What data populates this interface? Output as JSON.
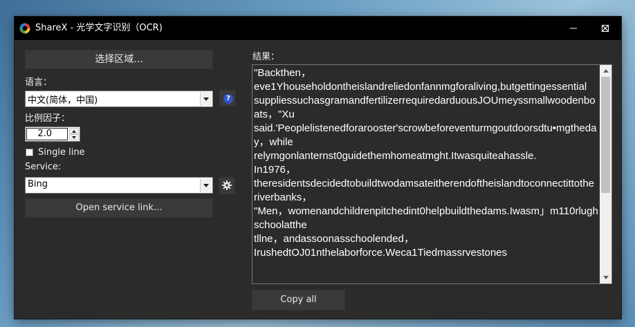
{
  "window": {
    "title": "ShareX - 光学文字识别（OCR)"
  },
  "left": {
    "select_region_label": "选择区域...",
    "language_label": "语言：",
    "language_value": "中文(简体，中国)",
    "scale_label": "比例因子：",
    "scale_value": "2.0",
    "single_line_label": "Single line",
    "single_line_checked": false,
    "service_label": "Service:",
    "service_value": "Bing",
    "open_service_link_label": "Open service link..."
  },
  "right": {
    "result_label": "结果：",
    "result_text": "\"Backthen，\neve1Yhouseholdontheislandreliedonfannmgforaliving,butgettingessential\nsuppliessuchasgramandfertilizerrequiredarduousJOUmeyssmallwoodenboats，\"Xu\nsaid.'Peoplelistenedforarooster'scrowbeforeventurmgoutdoorsdtu•mgtheday，while\nrelymgonlanternst0guidethemhomeatmght.Itwasquiteahassle.\nIn1976，\ntheresidentsdecidedtobuildtwodamsateitherendoftheislandtoconnectittothe\nriverbanks，\n\"Men，womenandchildrenpitchedint0helpbuildthedams.Iwasm」m110rlughschoolatthe\ntllne，andassoonasschoolended，\nIrushedtOJ01nthelaborforce.Weca1Tiedmassrvestones",
    "copy_all_label": "Copy all"
  },
  "colors": {
    "titlebar": "#000000",
    "window_bg": "#2b2b2b",
    "button_bg": "#3a3a3a",
    "help_icon": "#2f55c9"
  }
}
